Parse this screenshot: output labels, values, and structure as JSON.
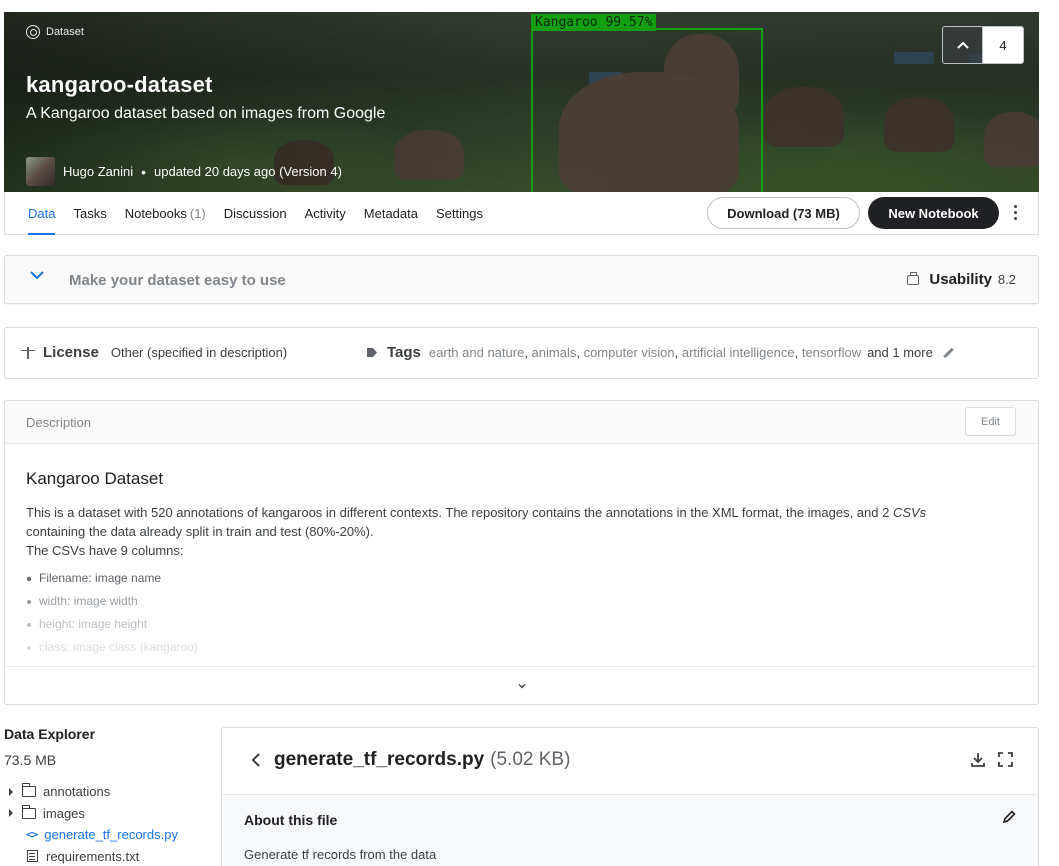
{
  "hero": {
    "type_label": "Dataset",
    "title": "kangaroo-dataset",
    "subtitle": "A Kangaroo dataset based on images from Google",
    "author": "Hugo Zanini",
    "updated": "updated 20 days ago (Version 4)",
    "detection_label": "Kangaroo 99.57%",
    "upvotes": "4"
  },
  "tabs": {
    "items": [
      {
        "label": "Data",
        "count": ""
      },
      {
        "label": "Tasks",
        "count": ""
      },
      {
        "label": "Notebooks",
        "count": "(1)"
      },
      {
        "label": "Discussion",
        "count": ""
      },
      {
        "label": "Activity",
        "count": ""
      },
      {
        "label": "Metadata",
        "count": ""
      },
      {
        "label": "Settings",
        "count": ""
      }
    ],
    "active": "Data",
    "download_label": "Download (73 MB)",
    "new_notebook_label": "New Notebook"
  },
  "usability": {
    "prompt": "Make your dataset easy to use",
    "label": "Usability",
    "score": "8.2"
  },
  "meta": {
    "license_label": "License",
    "license_value": "Other (specified in description)",
    "tags_label": "Tags",
    "tags": [
      "earth and nature",
      "animals",
      "computer vision",
      "artificial intelligence",
      "tensorflow"
    ],
    "tags_more": "and 1 more"
  },
  "description": {
    "header": "Description",
    "edit_label": "Edit",
    "heading": "Kangaroo Dataset",
    "paragraph_1a": "This is a dataset with 520 annotations of kangaroos in different contexts. The repository contains the annotations in the XML format, the images, and 2 ",
    "paragraph_1_em": "CSVs",
    "paragraph_1b": "containing the data already split in train and test (80%-20%).",
    "paragraph_2": "The CSVs have 9 columns:",
    "columns": [
      {
        "name": "Filename",
        "desc": "image name"
      },
      {
        "name": "width",
        "desc": "image width"
      },
      {
        "name": "height",
        "desc": "image height"
      },
      {
        "name": "class",
        "desc": "image class (kangaroo)"
      }
    ]
  },
  "explorer": {
    "title": "Data Explorer",
    "size": "73.5 MB",
    "items": [
      {
        "label": "annotations",
        "kind": "folder"
      },
      {
        "label": "images",
        "kind": "folder"
      },
      {
        "label": "generate_tf_records.py",
        "kind": "code"
      },
      {
        "label": "requirements.txt",
        "kind": "doc"
      }
    ]
  },
  "file": {
    "name": "generate_tf_records.py",
    "size": "(5.02 KB)",
    "about_title": "About this file",
    "about_text": "Generate tf records from the data"
  },
  "colors": {
    "accent": "#1a73e8",
    "detection": "#149e12",
    "primary_button": "#202124"
  }
}
